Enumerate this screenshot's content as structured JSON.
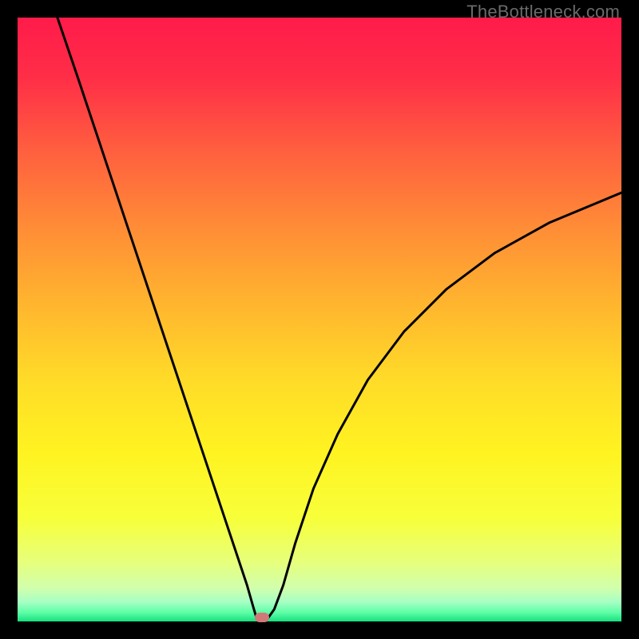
{
  "watermark": "TheBottleneck.com",
  "marker_color": "#cf7a78",
  "chart_data": {
    "type": "line",
    "title": "",
    "xlabel": "",
    "ylabel": "",
    "xlim": [
      0,
      100
    ],
    "ylim": [
      0,
      100
    ],
    "grid": false,
    "legend": false,
    "curve_description": "V-shaped bottleneck curve descending steeply on the left, reaching a minimum near x≈40 very close to y≈0, then rising with decreasing slope toward the right edge where it ends near y≈70.",
    "curve_points": [
      {
        "x": 6.6,
        "y": 100.0
      },
      {
        "x": 10.0,
        "y": 90.0
      },
      {
        "x": 14.0,
        "y": 78.0
      },
      {
        "x": 18.0,
        "y": 66.0
      },
      {
        "x": 22.0,
        "y": 54.0
      },
      {
        "x": 26.0,
        "y": 42.0
      },
      {
        "x": 30.0,
        "y": 30.0
      },
      {
        "x": 33.0,
        "y": 21.0
      },
      {
        "x": 36.0,
        "y": 12.0
      },
      {
        "x": 38.0,
        "y": 6.0
      },
      {
        "x": 39.0,
        "y": 2.5
      },
      {
        "x": 39.5,
        "y": 0.8
      },
      {
        "x": 40.5,
        "y": 0.6
      },
      {
        "x": 41.5,
        "y": 0.6
      },
      {
        "x": 42.5,
        "y": 2.0
      },
      {
        "x": 44.0,
        "y": 6.0
      },
      {
        "x": 46.0,
        "y": 13.0
      },
      {
        "x": 49.0,
        "y": 22.0
      },
      {
        "x": 53.0,
        "y": 31.0
      },
      {
        "x": 58.0,
        "y": 40.0
      },
      {
        "x": 64.0,
        "y": 48.0
      },
      {
        "x": 71.0,
        "y": 55.0
      },
      {
        "x": 79.0,
        "y": 61.0
      },
      {
        "x": 88.0,
        "y": 66.0
      },
      {
        "x": 100.0,
        "y": 71.0
      }
    ],
    "minimum_marker": {
      "x": 40.5,
      "y": 0.6
    },
    "background_gradient_stops": [
      {
        "pos": 0.0,
        "color": "#ff1b4a"
      },
      {
        "pos": 0.1,
        "color": "#ff2e47"
      },
      {
        "pos": 0.22,
        "color": "#ff5f3f"
      },
      {
        "pos": 0.35,
        "color": "#ff8d36"
      },
      {
        "pos": 0.48,
        "color": "#ffb72e"
      },
      {
        "pos": 0.6,
        "color": "#ffdb28"
      },
      {
        "pos": 0.72,
        "color": "#fff321"
      },
      {
        "pos": 0.83,
        "color": "#f7ff3a"
      },
      {
        "pos": 0.9,
        "color": "#e7ff7a"
      },
      {
        "pos": 0.945,
        "color": "#d1ffad"
      },
      {
        "pos": 0.968,
        "color": "#a6ffc4"
      },
      {
        "pos": 0.985,
        "color": "#5effa7"
      },
      {
        "pos": 1.0,
        "color": "#17e07f"
      }
    ]
  }
}
